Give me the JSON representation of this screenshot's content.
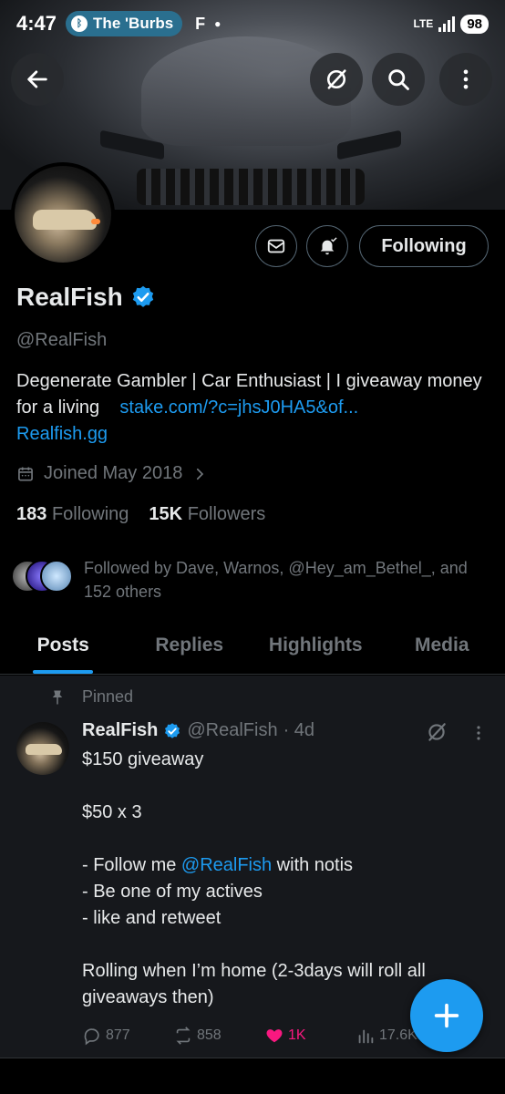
{
  "status_bar": {
    "time": "4:47",
    "now_playing": "The 'Burbs",
    "app_letter": "F",
    "network": "LTE",
    "battery": "98"
  },
  "header": {
    "back_icon": "arrow-left-icon",
    "grok_icon": "grok-icon",
    "search_icon": "search-icon",
    "more_icon": "more-vertical-icon"
  },
  "profile": {
    "name": "RealFish",
    "handle": "@RealFish",
    "bio_text": "Degenerate Gambler | Car Enthusiast | I giveaway money for a living",
    "bio_link": "stake.com/?c=jhsJ0HA5&of...",
    "website": "Realfish.gg",
    "joined": "Joined May 2018",
    "following_count": "183",
    "following_label": "Following",
    "followers_count": "15K",
    "followers_label": "Followers",
    "followed_by": "Followed by Dave, Warnos, @Hey_am_Bethel_, and 152 others",
    "follow_button": "Following"
  },
  "tabs": [
    "Posts",
    "Replies",
    "Highlights",
    "Media"
  ],
  "pinned_post": {
    "pinned_label": "Pinned",
    "author": "RealFish",
    "handle": "@RealFish",
    "time": "· 4d",
    "line1": "$150 giveaway",
    "line2": "$50 x 3",
    "line3_pre": "- Follow me ",
    "line3_mention": "@RealFish",
    "line3_post": " with notis",
    "line4": "- Be one of my actives",
    "line5": "- like and retweet",
    "line6": "Rolling when I’m home (2-3days will roll all giveaways then)",
    "replies": "877",
    "reposts": "858",
    "likes": "1K",
    "views": "17.6K"
  },
  "colors": {
    "accent": "#1d9bf0",
    "like": "#f91880",
    "muted": "#71767b",
    "background": "#000000"
  }
}
